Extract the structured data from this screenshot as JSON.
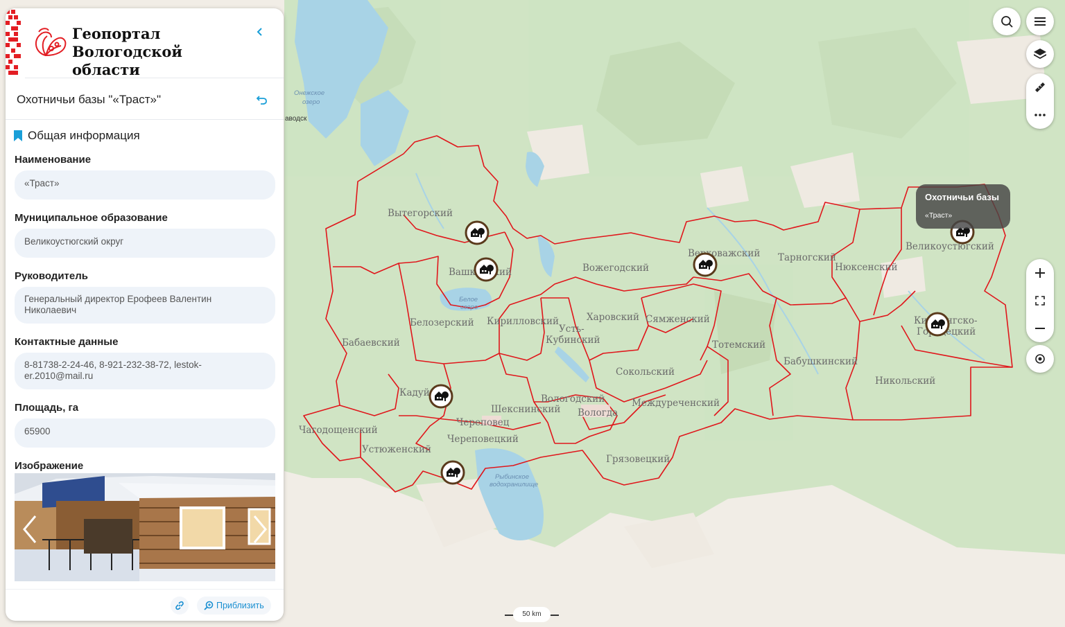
{
  "brand": {
    "title_line1": "Геопортал",
    "title_line2": "Вологодской области"
  },
  "object": {
    "title": "Охотничьи базы \"«Траст»\""
  },
  "section_title": "Общая информация",
  "fields": [
    {
      "label": "Наименование",
      "value": "«Траст»"
    },
    {
      "label": "Муниципальное образование",
      "value": "Великоустюгский округ"
    },
    {
      "label": "Руководитель",
      "value": "Генеральный директор Ерофеев Валентин Николаевич"
    },
    {
      "label": "Контактные данные",
      "value": "8-81738-2-24-46, 8-921-232-38-72, lestok-er.2010@mail.ru"
    },
    {
      "label": "Площадь, га",
      "value": "65900"
    }
  ],
  "image_label": "Изображение",
  "footer": {
    "zoom_label": "Приблизить"
  },
  "popup": {
    "title": "Охотничьи базы",
    "subtitle": "«Траст»"
  },
  "scale": {
    "label": "50 km"
  },
  "water_labels": {
    "onega": [
      "Онежское",
      "озеро"
    ],
    "beloe": [
      "Белое",
      "озеро"
    ],
    "rybinsk": [
      "Рыбинское",
      "водохранилище"
    ],
    "city_edge": "аводск"
  },
  "districts": [
    {
      "name": "Вытегорский"
    },
    {
      "name": "Вашкинский"
    },
    {
      "name": "Вожегодский"
    },
    {
      "name": "Верховажский"
    },
    {
      "name": "Тарногский"
    },
    {
      "name": "Нюксенский"
    },
    {
      "name": "Великоустюгский"
    },
    {
      "name": "Белозерский"
    },
    {
      "name": "Кирилловский"
    },
    {
      "name": "Усть-"
    },
    {
      "name": "Кубинский"
    },
    {
      "name": "Харовский"
    },
    {
      "name": "Сямженский"
    },
    {
      "name": "Тотемский"
    },
    {
      "name": "Бабаевский"
    },
    {
      "name": "Кичменгско-"
    },
    {
      "name": "Городецкий"
    },
    {
      "name": "Бабушкинский"
    },
    {
      "name": "Сокольский"
    },
    {
      "name": "Никольский"
    },
    {
      "name": "Кадуй"
    },
    {
      "name": "Шекснинский"
    },
    {
      "name": "Вологодский"
    },
    {
      "name": "Вологда"
    },
    {
      "name": "Междуреченский"
    },
    {
      "name": "Череповец"
    },
    {
      "name": "Чагодощенский"
    },
    {
      "name": "Череповецкий"
    },
    {
      "name": "Устюженский"
    },
    {
      "name": "Грязовецкий"
    }
  ],
  "icons": {
    "search": "search-icon",
    "menu": "menu-icon",
    "layers": "layers-icon",
    "ruler": "ruler-icon",
    "more": "more-icon",
    "zoom_in": "plus-icon",
    "fullscreen": "fullscreen-icon",
    "zoom_out": "minus-icon",
    "locate": "locate-icon",
    "marker": "hunting-base-marker-icon"
  },
  "colors": {
    "accent": "#1a9fd8",
    "border": "#e0161b",
    "forest": "#cfe5c5",
    "water": "#a8d3e6"
  }
}
